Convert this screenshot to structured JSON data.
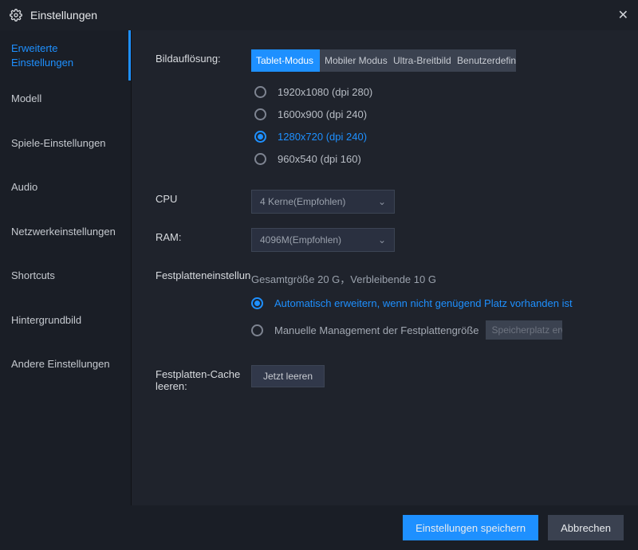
{
  "title": "Einstellungen",
  "sidebar": {
    "items": [
      {
        "label": "Erweiterte\nEinstellungen"
      },
      {
        "label": "Modell"
      },
      {
        "label": "Spiele-Einstellungen"
      },
      {
        "label": "Audio"
      },
      {
        "label": "Netzwerkeinstellungen"
      },
      {
        "label": "Shortcuts"
      },
      {
        "label": "Hintergrundbild"
      },
      {
        "label": "Andere Einstellungen"
      }
    ],
    "active_index": 0
  },
  "resolution": {
    "label": "Bildauflösung:",
    "tabs": [
      {
        "label": "Tablet-Modus"
      },
      {
        "label": "Mobiler Modus"
      },
      {
        "label": "Ultra-Breitbild"
      },
      {
        "label": "Benutzerdefiniert"
      }
    ],
    "active_tab_index": 0,
    "options": [
      {
        "label": "1920x1080  (dpi 280)"
      },
      {
        "label": "1600x900  (dpi 240)"
      },
      {
        "label": "1280x720  (dpi 240)"
      },
      {
        "label": "960x540  (dpi 160)"
      }
    ],
    "selected_index": 2
  },
  "cpu": {
    "label": "CPU",
    "value": "4 Kerne(Empfohlen)"
  },
  "ram": {
    "label": "RAM:",
    "value": "4096M(Empfohlen)"
  },
  "disk": {
    "label": "Festplatteneinstellung",
    "info": "Gesamtgröße 20 G，Verbleibende 10 G",
    "auto": "Automatisch erweitern, wenn nicht genügend Platz vorhanden ist",
    "manual": "Manuelle Management der Festplattengröße",
    "manage_btn": "Speicherplatz erweitern",
    "selected": "auto"
  },
  "cache": {
    "label": "Festplatten-Cache leeren:",
    "btn": "Jetzt leeren"
  },
  "footer": {
    "save": "Einstellungen speichern",
    "cancel": "Abbrechen"
  }
}
